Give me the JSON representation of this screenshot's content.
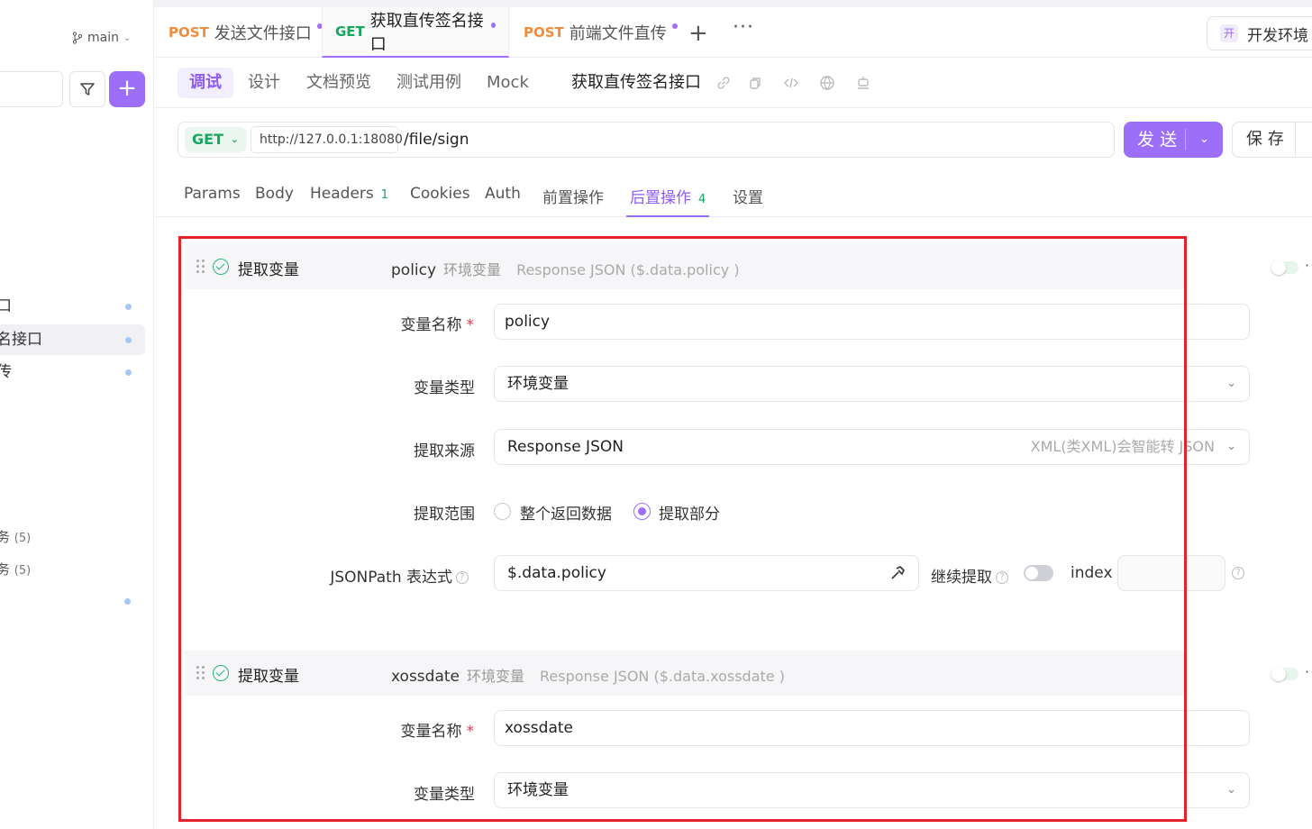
{
  "sidebar": {
    "branch": "main",
    "items": [
      {
        "label": "口",
        "active": false
      },
      {
        "label": "名接口",
        "active": true
      },
      {
        "label": "传",
        "active": false
      }
    ],
    "groups": [
      {
        "label": "务",
        "count": "(5)"
      },
      {
        "label": "务",
        "count": "(5)"
      }
    ]
  },
  "tabs": [
    {
      "method": "POST",
      "label": "发送文件接口",
      "active": false
    },
    {
      "method": "GET",
      "label": "获取直传签名接口",
      "active": true
    },
    {
      "method": "POST",
      "label": "前端文件直传",
      "active": false
    }
  ],
  "tab_actions": {
    "add": "+",
    "more": "···"
  },
  "environment": {
    "icon_text": "开",
    "label": "开发环境"
  },
  "subtabs": [
    "调试",
    "设计",
    "文档预览",
    "测试用例",
    "Mock"
  ],
  "api_title": "获取直传签名接口",
  "request": {
    "method": "GET",
    "host": "http://127.0.0.1:18080",
    "path": "/file/sign",
    "send_label": "发 送",
    "save_label": "保 存"
  },
  "request_tabs": [
    {
      "label": "Params",
      "badge": ""
    },
    {
      "label": "Body",
      "badge": ""
    },
    {
      "label": "Headers",
      "badge": "1"
    },
    {
      "label": "Cookies",
      "badge": ""
    },
    {
      "label": "Auth",
      "badge": ""
    },
    {
      "label": "前置操作",
      "badge": ""
    },
    {
      "label": "后置操作",
      "badge": "4"
    },
    {
      "label": "设置",
      "badge": ""
    }
  ],
  "extract1": {
    "title": "提取变量",
    "name": "policy",
    "type": "环境变量",
    "source": "Response JSON ($.data.policy )",
    "fields": {
      "var_name_label": "变量名称",
      "var_name_value": "policy",
      "var_type_label": "变量类型",
      "var_type_value": "环境变量",
      "source_label": "提取来源",
      "source_value": "Response JSON",
      "source_hint": "XML(类XML)会智能转 JSON",
      "range_label": "提取范围",
      "range_all": "整个返回数据",
      "range_part": "提取部分",
      "range_selected": "提取部分",
      "jsonpath_label": "JSONPath 表达式",
      "jsonpath_value": "$.data.policy",
      "continue_label": "继续提取",
      "continue_enabled": false,
      "index_label": "index",
      "index_value": ""
    }
  },
  "extract2": {
    "title": "提取变量",
    "name": "xossdate",
    "type": "环境变量",
    "source": "Response JSON ($.data.xossdate )",
    "fields": {
      "var_name_label": "变量名称",
      "var_name_value": "xossdate",
      "var_type_label": "变量类型",
      "var_type_value": "环境变量"
    }
  },
  "required_mark": "*",
  "help_mark": "?"
}
